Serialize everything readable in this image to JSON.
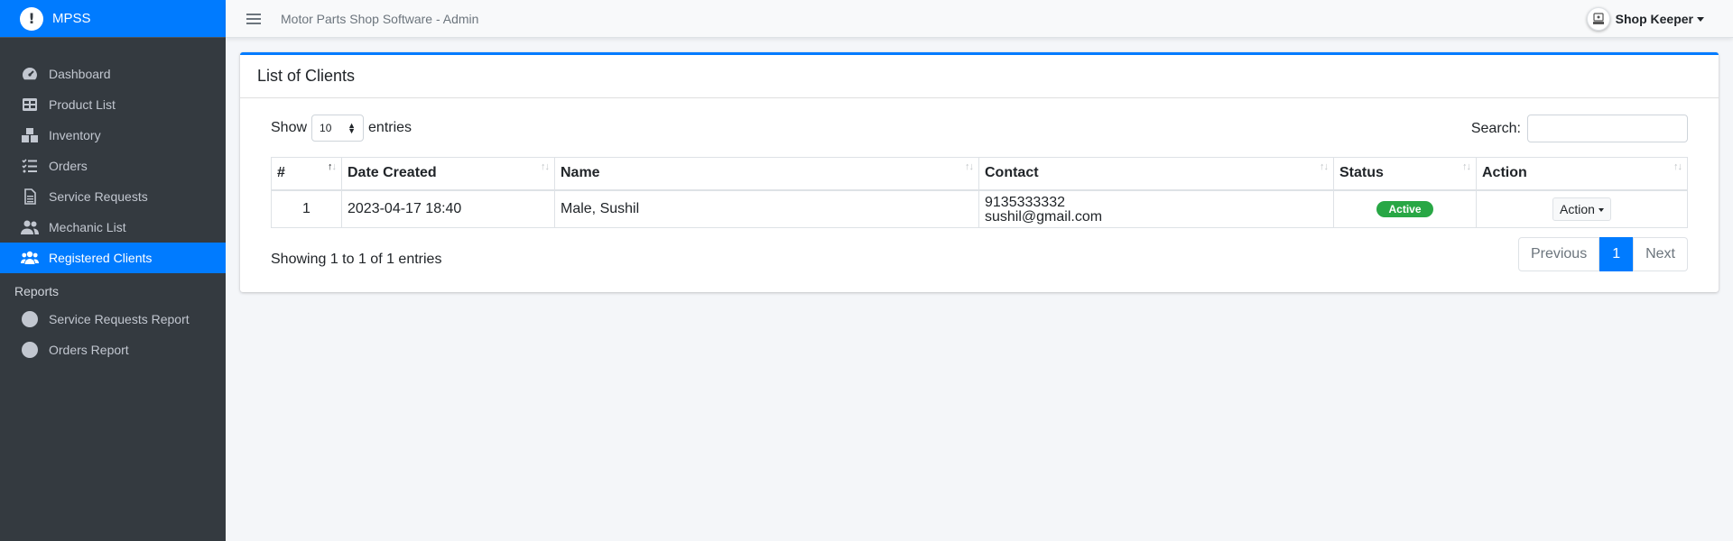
{
  "brand": {
    "logo_glyph": "!",
    "name": "MPSS"
  },
  "sidebar": {
    "items": [
      {
        "label": "Dashboard",
        "icon": "tachometer-icon"
      },
      {
        "label": "Product List",
        "icon": "table-icon"
      },
      {
        "label": "Inventory",
        "icon": "boxes-icon"
      },
      {
        "label": "Orders",
        "icon": "list-check-icon"
      },
      {
        "label": "Service Requests",
        "icon": "file-icon"
      },
      {
        "label": "Mechanic List",
        "icon": "user-group-icon"
      },
      {
        "label": "Registered Clients",
        "icon": "users-icon",
        "active": true
      }
    ],
    "reports_header": "Reports",
    "report_items": [
      {
        "label": "Service Requests Report",
        "icon": "circle-icon"
      },
      {
        "label": "Orders Report",
        "icon": "circle-icon"
      }
    ]
  },
  "navbar": {
    "title": "Motor Parts Shop Software - Admin",
    "user_name": "Shop Keeper"
  },
  "card": {
    "title": "List of Clients",
    "show_label": "Show",
    "entries_value": "10",
    "entries_label": "entries",
    "search_label": "Search:",
    "search_value": ""
  },
  "table": {
    "headers": [
      "#",
      "Date Created",
      "Name",
      "Contact",
      "Status",
      "Action"
    ],
    "rows": [
      {
        "num": "1",
        "date": "2023-04-17 18:40",
        "name": "Male, Sushil",
        "phone": "9135333332",
        "email": "sushil@gmail.com",
        "status": "Active",
        "action": "Action"
      }
    ]
  },
  "footer": {
    "info": "Showing 1 to 1 of 1 entries",
    "previous": "Previous",
    "current_page": "1",
    "next": "Next"
  },
  "colors": {
    "primary": "#007bff",
    "sidebar_bg": "#343a40",
    "success": "#28a745",
    "content_bg": "#f4f6f9"
  }
}
